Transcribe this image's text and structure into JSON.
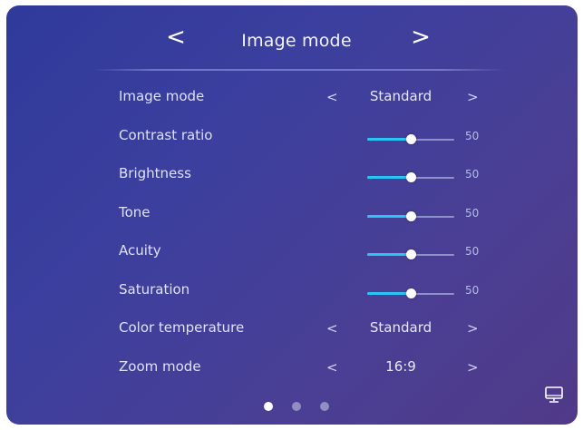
{
  "header": {
    "title": "Image mode",
    "prev_arrow": "<",
    "next_arrow": ">"
  },
  "rows": [
    {
      "label": "Image mode",
      "type": "select",
      "value": "Standard"
    },
    {
      "label": "Contrast ratio",
      "type": "slider",
      "value": "50",
      "fraction": 0.5
    },
    {
      "label": "Brightness",
      "type": "slider",
      "value": "50",
      "fraction": 0.5
    },
    {
      "label": "Tone",
      "type": "slider",
      "value": "50",
      "fraction": 0.5
    },
    {
      "label": "Acuity",
      "type": "slider",
      "value": "50",
      "fraction": 0.5
    },
    {
      "label": "Saturation",
      "type": "slider",
      "value": "50",
      "fraction": 0.5
    },
    {
      "label": "Color temperature",
      "type": "select",
      "value": "Standard"
    },
    {
      "label": "Zoom mode",
      "type": "select",
      "value": "16:9"
    }
  ],
  "selector_arrows": {
    "left": "<",
    "right": ">"
  },
  "pagination": {
    "total": 3,
    "active_index": 0
  },
  "icons": {
    "corner": "monitor-icon"
  },
  "colors": {
    "accent": "#29c6f5",
    "text": "#ffffff",
    "inactive_dot": "#8f8fc4"
  }
}
